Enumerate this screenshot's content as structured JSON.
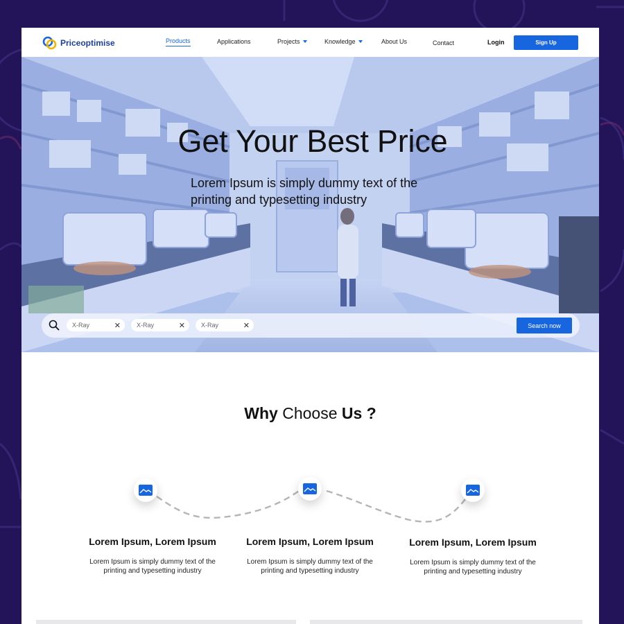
{
  "brand": {
    "name": "Priceoptimise",
    "accent": "#1766e0",
    "background": "#23145a"
  },
  "nav": {
    "items": [
      {
        "label": "Products",
        "active": true,
        "dropdown": false
      },
      {
        "label": "Applications",
        "active": false,
        "dropdown": false
      },
      {
        "label": "Projects",
        "active": false,
        "dropdown": true
      },
      {
        "label": "Knowledge",
        "active": false,
        "dropdown": true
      },
      {
        "label": "About Us",
        "active": false,
        "dropdown": false
      },
      {
        "label": "Contact",
        "active": false,
        "dropdown": false
      }
    ],
    "login_label": "Login",
    "signup_label": "Sign Up"
  },
  "hero": {
    "title": "Get Your Best Price",
    "subtitle": "Lorem Ipsum is simply dummy text of the printing and typesetting industry",
    "search": {
      "icon": "search-icon",
      "chips": [
        "X-Ray",
        "X-Ray",
        "X-Ray"
      ],
      "button_label": "Search now"
    }
  },
  "why": {
    "title_bold_1": "Why",
    "title_regular": "Choose",
    "title_bold_2": "Us ?",
    "features": [
      {
        "icon": "image-icon",
        "title": "Lorem Ipsum, Lorem Ipsum",
        "desc": "Lorem Ipsum is simply dummy text of the printing and typesetting industry"
      },
      {
        "icon": "image-icon",
        "title": "Lorem Ipsum, Lorem Ipsum",
        "desc": "Lorem Ipsum is simply dummy text of the printing and typesetting industry"
      },
      {
        "icon": "image-icon",
        "title": "Lorem Ipsum, Lorem Ipsum",
        "desc": "Lorem Ipsum is simply dummy text of the printing and typesetting industry"
      }
    ]
  }
}
